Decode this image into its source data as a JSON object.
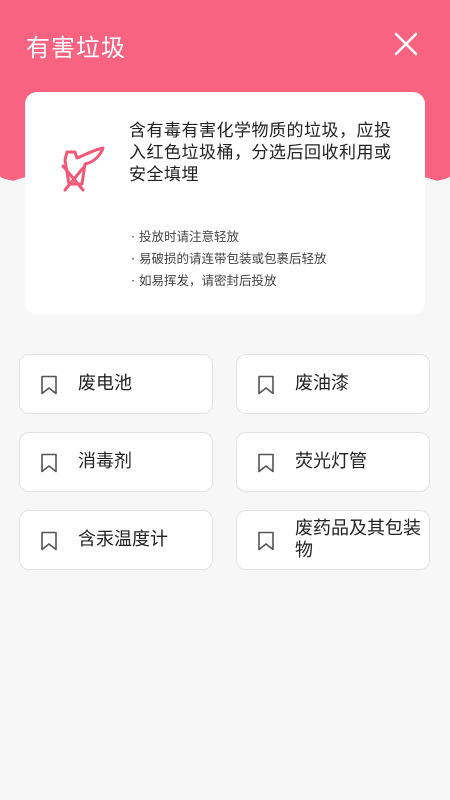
{
  "header": {
    "title": "有害垃圾",
    "close_icon": "close-icon",
    "color": "#f76380"
  },
  "info": {
    "icon": "hazardous-bin-icon",
    "description": "含有毒有害化学物质的垃圾，应投入红色垃圾桶，分选后回收利用或安全填埋",
    "tips": [
      "投放时请注意轻放",
      "易破损的请连带包装或包裹后轻放",
      "如易挥发，请密封后投放"
    ]
  },
  "items": [
    {
      "label": "废电池",
      "icon": "bookmark-icon"
    },
    {
      "label": "废油漆",
      "icon": "bookmark-icon"
    },
    {
      "label": "消毒剂",
      "icon": "bookmark-icon"
    },
    {
      "label": "荧光灯管",
      "icon": "bookmark-icon"
    },
    {
      "label": "含汞温度计",
      "icon": "bookmark-icon"
    },
    {
      "label": "废药品及其包装物",
      "icon": "bookmark-icon"
    }
  ]
}
